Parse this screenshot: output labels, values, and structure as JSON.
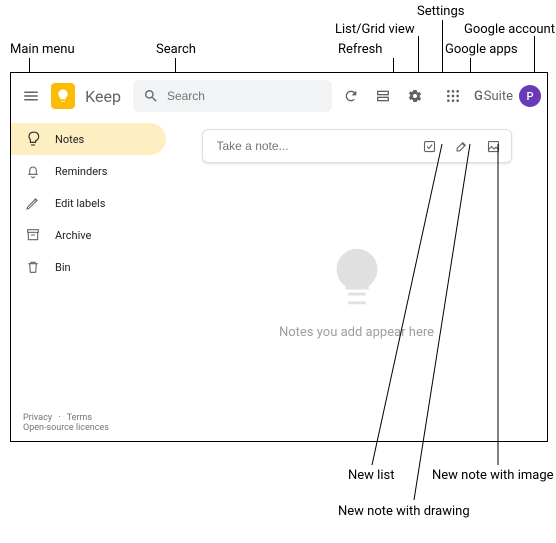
{
  "callouts": {
    "main_menu": "Main menu",
    "search": "Search",
    "refresh": "Refresh",
    "listgrid": "List/Grid view",
    "settings": "Settings",
    "google_apps": "Google apps",
    "google_account": "Google account",
    "new_list": "New list",
    "new_drawing": "New note with drawing",
    "new_image": "New note with image"
  },
  "topbar": {
    "brand": "Keep",
    "search_placeholder": "Search",
    "gsuite_g": "G",
    "gsuite_suite": "Suite",
    "avatar_initial": "P"
  },
  "sidebar": {
    "items": [
      {
        "label": "Notes"
      },
      {
        "label": "Reminders"
      },
      {
        "label": "Edit labels"
      },
      {
        "label": "Archive"
      },
      {
        "label": "Bin"
      }
    ]
  },
  "note_input": {
    "placeholder": "Take a note..."
  },
  "empty_state": {
    "text": "Notes you add appear here"
  },
  "footer": {
    "privacy": "Privacy",
    "dot": "·",
    "terms": "Terms",
    "oss": "Open-source licences"
  }
}
